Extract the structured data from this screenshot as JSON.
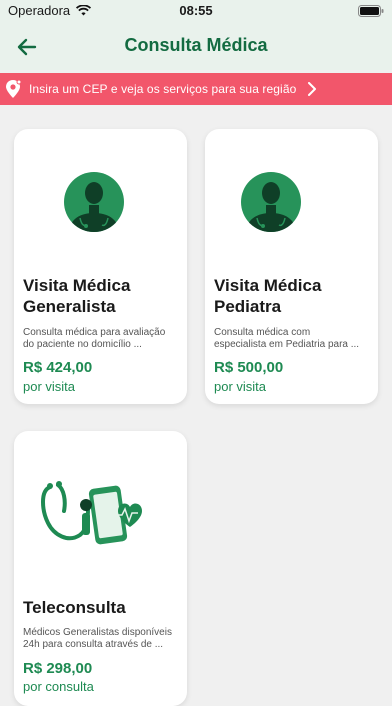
{
  "status_bar": {
    "carrier": "Operadora",
    "time": "08:55"
  },
  "header": {
    "title": "Consulta Médica",
    "back_icon": "arrow-left-icon"
  },
  "cep_banner": {
    "text": "Insira um CEP e veja os serviços para sua região",
    "background": "#f2566b"
  },
  "services": [
    {
      "title_line1": "Visita Médica",
      "title_line2": "Generalista",
      "desc_line1": "Consulta médica para avaliação",
      "desc_line2": "do paciente no domicílio ...",
      "price": "R$ 424,00",
      "unit": "por visita",
      "icon": "doctor-avatar-icon"
    },
    {
      "title_line1": "Visita Médica",
      "title_line2": "Pediatra",
      "desc_line1": "Consulta médica com",
      "desc_line2": "especialista em Pediatria para ...",
      "price": "R$ 500,00",
      "unit": "por visita",
      "icon": "doctor-avatar-icon"
    },
    {
      "title_line1": "Teleconsulta",
      "title_line2": "",
      "desc_line1": "Médicos Generalistas disponíveis",
      "desc_line2": "24h para consulta através de ...",
      "price": "R$ 298,00",
      "unit": "por consulta",
      "icon": "stethoscope-phone-icon"
    }
  ],
  "colors": {
    "brand_green": "#136b41",
    "price_green": "#1e8a52",
    "header_bg": "#e9f2ec"
  }
}
